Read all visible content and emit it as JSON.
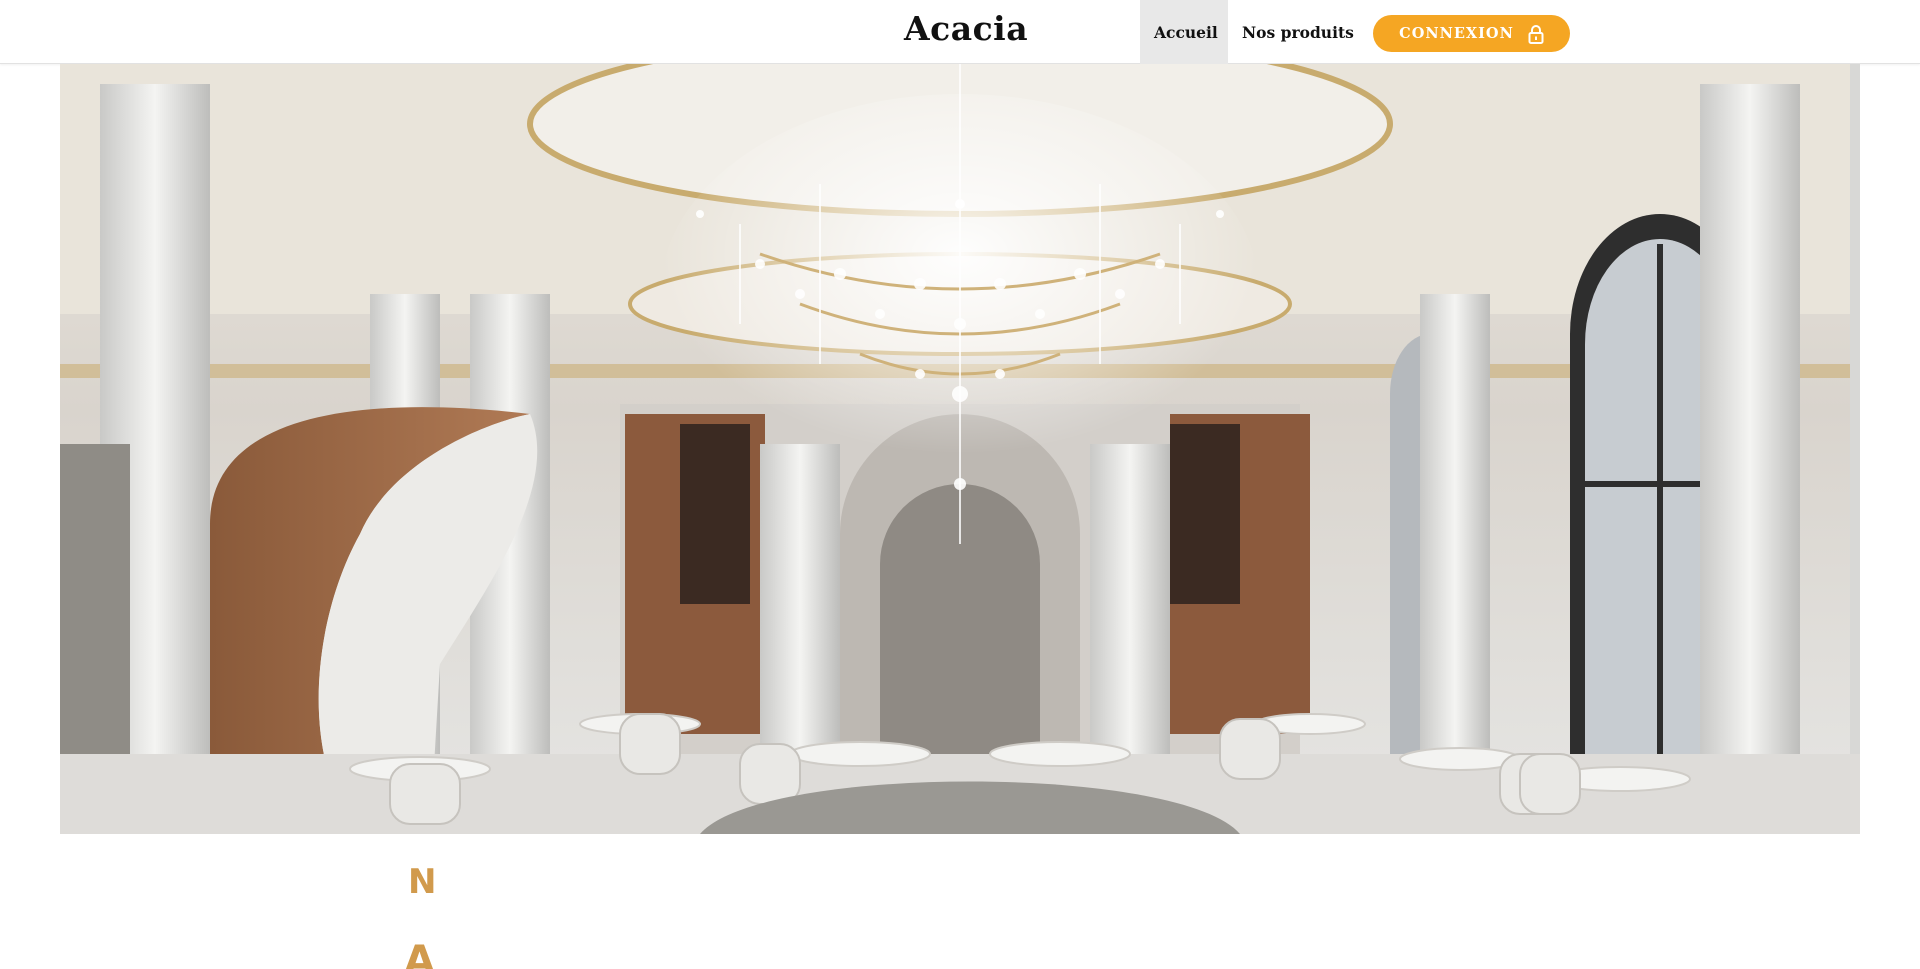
{
  "header": {
    "brand": "Acacia",
    "nav": [
      {
        "label": "Accueil",
        "active": true
      },
      {
        "label": "Nos produits",
        "active": false
      }
    ],
    "login_label": "CONNEXION",
    "login_icon": "padlock-icon",
    "accent_color": "#f5a623"
  },
  "hero": {
    "image": "restaurant-dining-room-with-chandelier"
  },
  "content": {
    "decorative_letters": [
      "N",
      "A"
    ],
    "decorative_color": "#d19a4c"
  }
}
